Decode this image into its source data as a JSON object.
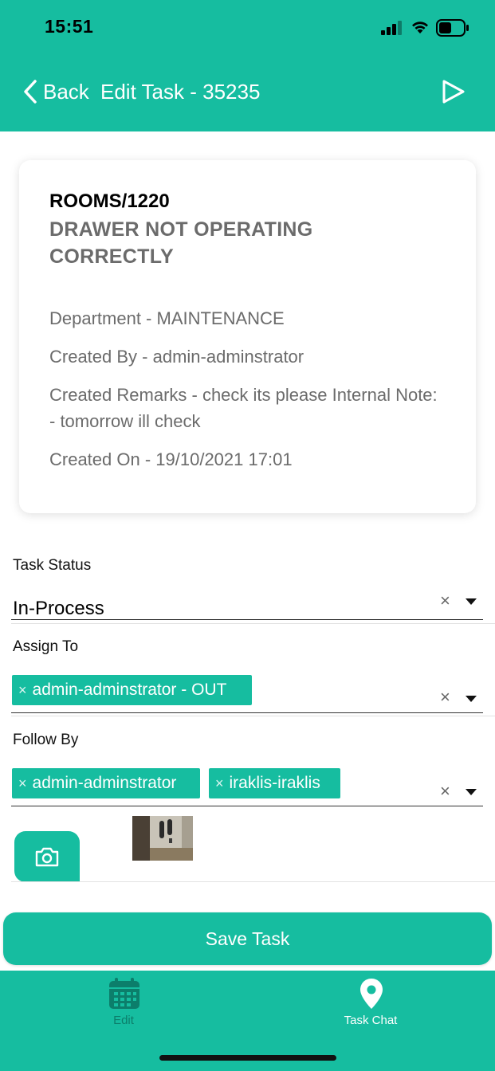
{
  "status_bar": {
    "time": "15:51"
  },
  "nav": {
    "back_label": "Back",
    "title": "Edit Task - 35235"
  },
  "card": {
    "room": "ROOMS/1220",
    "task_name": "DRAWER NOT OPERATING CORRECTLY",
    "department": "Department - MAINTENANCE",
    "created_by": "Created By - admin-adminstrator",
    "created_remarks": "Created Remarks - check its please Internal Note: - tomorrow ill check",
    "created_on": "Created On - 19/10/2021 17:01"
  },
  "form": {
    "task_status": {
      "label": "Task Status",
      "value": "In-Process"
    },
    "assign_to": {
      "label": "Assign To",
      "chips": [
        "admin-adminstrator - OUT"
      ]
    },
    "follow_by": {
      "label": "Follow By",
      "chips": [
        "admin-adminstrator",
        "iraklis-iraklis"
      ]
    },
    "clear_symbol": "×",
    "chip_remove_symbol": "×"
  },
  "actions": {
    "save_label": "Save Task"
  },
  "tabbar": {
    "edit_label": "Edit",
    "chat_label": "Task Chat"
  },
  "colors": {
    "accent": "#16bda0",
    "inactive_tab": "#0c7e6b"
  },
  "icons": [
    "back-chevron-icon",
    "play-icon",
    "camera-icon",
    "calendar-icon",
    "location-pin-icon"
  ]
}
